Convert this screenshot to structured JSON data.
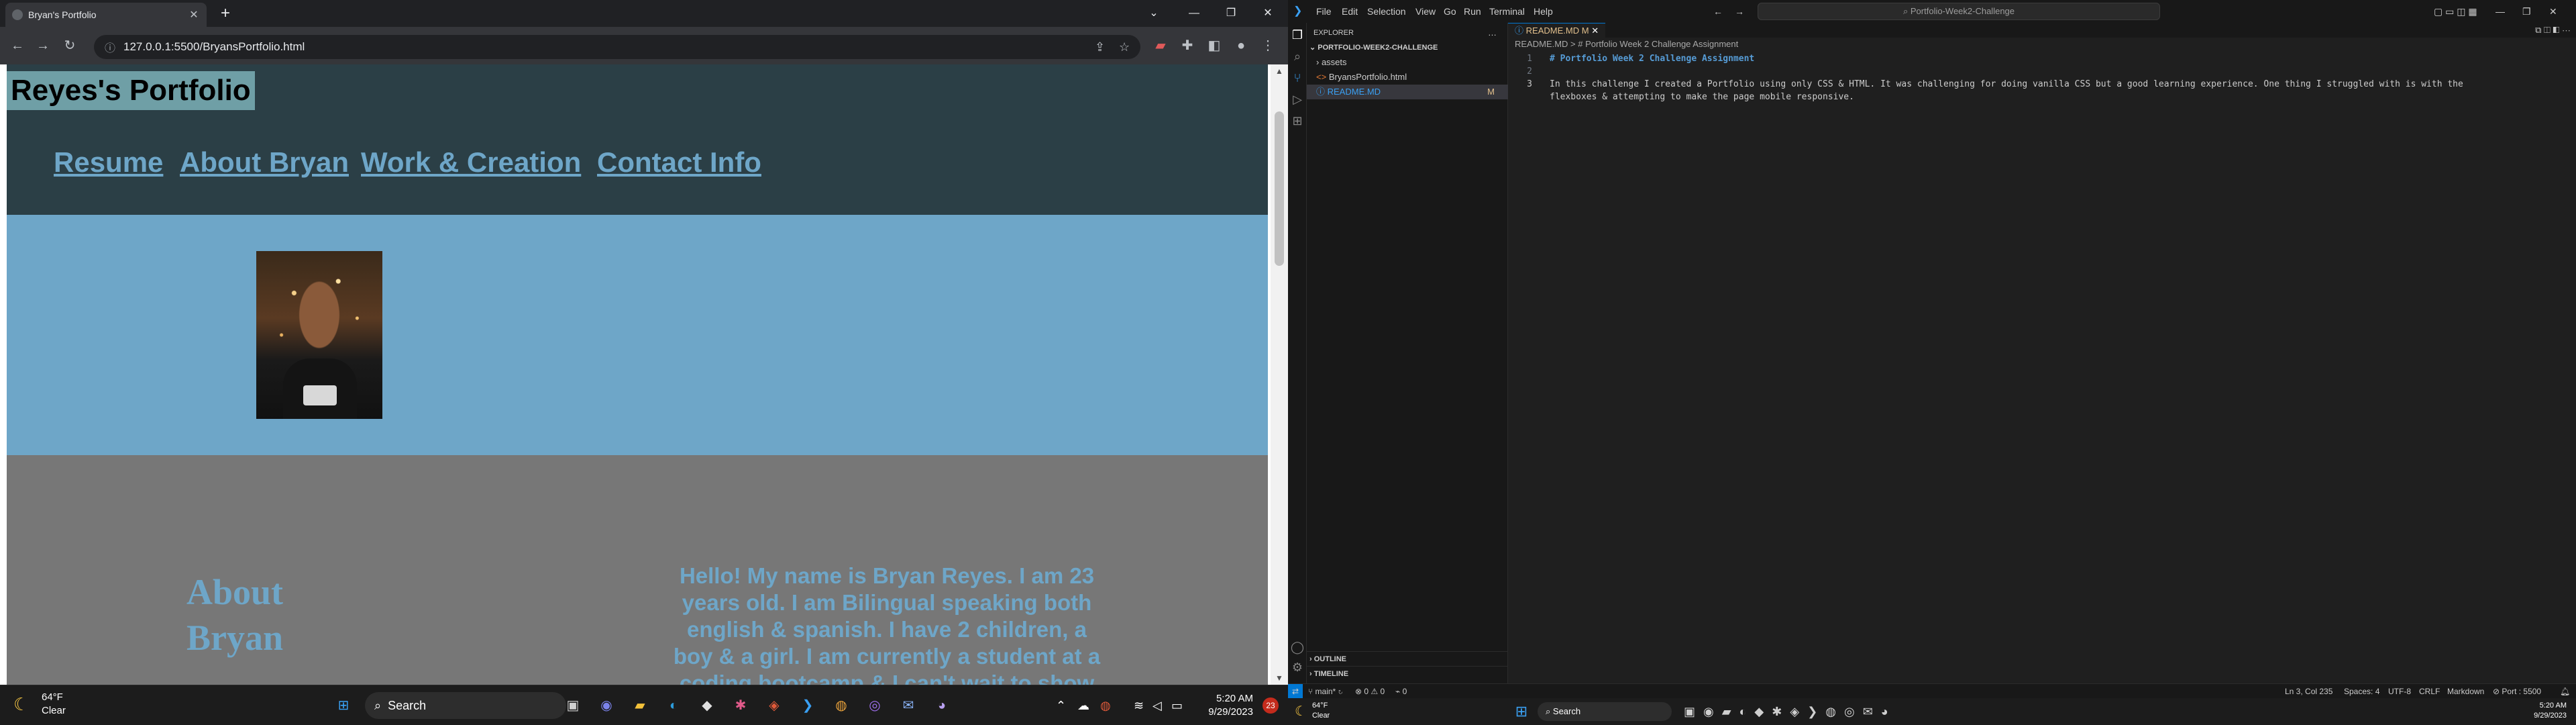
{
  "chrome": {
    "tab_title": "Bryan's Portfolio",
    "url": "127.0.0.1:5500/BryansPortfolio.html"
  },
  "site": {
    "title": "Reyes's Portfolio",
    "nav": [
      "Resume",
      "About Bryan",
      "Work & Creation",
      "Contact Info"
    ],
    "about_heading": "About Bryan",
    "about_text": "Hello! My name is Bryan Reyes. I am 23 years old. I am Bilingual speaking both english & spanish. I have 2 children, a boy & a girl. I am currently a student at a coding bootcamp & I can't wait to show"
  },
  "taskbar_left": {
    "weather_temp": "64°F",
    "weather_cond": "Clear",
    "search_label": "Search",
    "time": "5:20 AM",
    "date": "9/29/2023",
    "notifications": "23"
  },
  "vscode": {
    "menu": [
      "File",
      "Edit",
      "Selection",
      "View",
      "Go",
      "Run",
      "Terminal",
      "Help"
    ],
    "command_center": "Portfolio-Week2-Challenge",
    "explorer_title": "EXPLORER",
    "folder": "PORTFOLIO-WEEK2-CHALLENGE",
    "files": [
      "assets",
      "BryansPortfolio.html",
      "README.MD"
    ],
    "readme_badge": "M",
    "outline": "OUTLINE",
    "timeline": "TIMELINE",
    "tab": "README.MD",
    "tab_badge": "M",
    "breadcrumb": "README.MD > # Portfolio Week 2 Challenge Assignment",
    "lines": [
      "# Portfolio Week 2 Challenge Assignment",
      "",
      "In this challenge I created a Portfolio using only CSS & HTML. It was challenging for doing vanilla CSS but a good learning experience. One thing I struggled with is with the",
      "flexboxes & attempting to make the page mobile responsive."
    ],
    "status": {
      "branch": "main*",
      "problems": "⊗ 0 ⚠ 0",
      "ports": "0",
      "position": "Ln 3, Col 235",
      "spaces": "Spaces: 4",
      "encoding": "UTF-8",
      "eol": "CRLF",
      "language": "Markdown",
      "port": "Port : 5500"
    }
  },
  "taskbar_right": {
    "weather_temp": "64°F",
    "weather_cond": "Clear",
    "search_label": "Search",
    "time": "5:20 AM",
    "date": "9/29/2023"
  },
  "colors": {
    "header_bg": "#2b3f46",
    "hero_bg": "#6ea6c8",
    "about_bg": "#777777",
    "accent": "#6ea6c8"
  }
}
